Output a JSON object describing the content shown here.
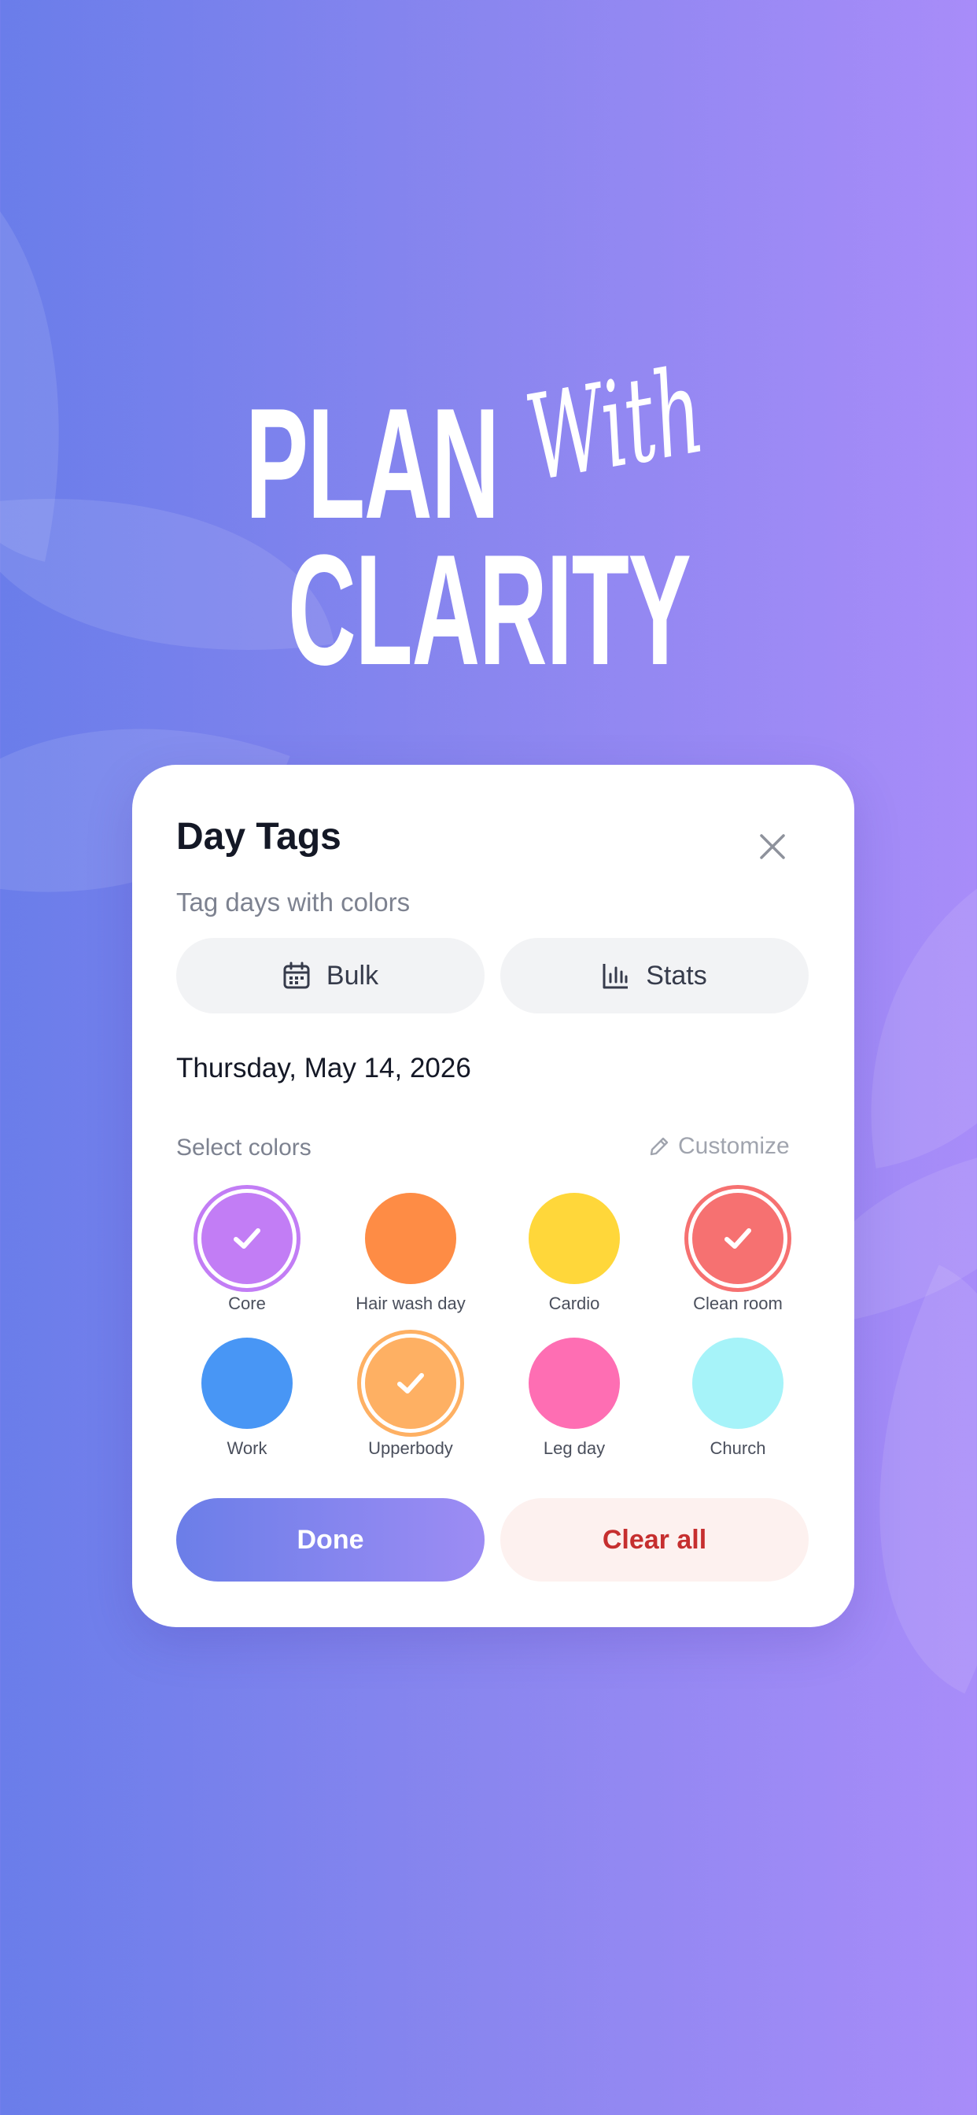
{
  "hero": {
    "line1": "PLAN",
    "script_word": "With",
    "line2": "CLARITY"
  },
  "modal": {
    "title": "Day Tags",
    "subtitle": "Tag days with colors",
    "close_icon": "close-icon",
    "bulk_button": {
      "label": "Bulk",
      "icon": "calendar-icon"
    },
    "stats_button": {
      "label": "Stats",
      "icon": "bar-chart-icon"
    },
    "date": "Thursday, May 14, 2026",
    "select_colors_label": "Select colors",
    "customize": {
      "label": "Customize",
      "icon": "pencil-icon"
    },
    "tags": [
      {
        "label": "Core",
        "color": "#c27df5",
        "selected": true
      },
      {
        "label": "Hair wash day",
        "color": "#fe8c45",
        "selected": false
      },
      {
        "label": "Cardio",
        "color": "#ffd73a",
        "selected": false
      },
      {
        "label": "Clean room",
        "color": "#f67171",
        "selected": true
      },
      {
        "label": "Work",
        "color": "#4896f5",
        "selected": false
      },
      {
        "label": "Upperbody",
        "color": "#feb063",
        "selected": true
      },
      {
        "label": "Leg day",
        "color": "#fe6eb3",
        "selected": false
      },
      {
        "label": "Church",
        "color": "#a6f3f9",
        "selected": false
      }
    ],
    "done_label": "Done",
    "clear_label": "Clear all"
  },
  "colors": {
    "bg_start": "#6a7dea",
    "bg_end": "#a88cf9",
    "danger": "#c62f2f"
  }
}
